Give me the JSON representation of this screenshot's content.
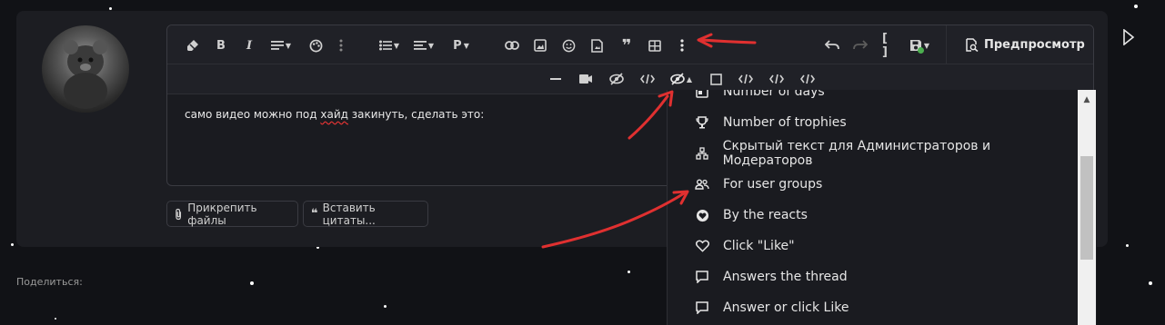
{
  "toolbar": {
    "preview_label": "Предпросмотр",
    "paragraph_label": "P"
  },
  "editor": {
    "text_before": "само видео можно под ",
    "text_misspelled": "хайд",
    "text_after": " закинуть, сделать это:"
  },
  "buttons": {
    "attach_files": "Прикрепить файлы",
    "insert_quotes": "Вставить цитаты..."
  },
  "share_label": "Поделиться:",
  "dropdown": {
    "items": [
      {
        "label": "Number of days",
        "icon": "calendar-icon"
      },
      {
        "label": "Number of trophies",
        "icon": "trophy-icon"
      },
      {
        "label": "Скрытый текст для Администраторов и Модераторов",
        "icon": "sitemap-icon"
      },
      {
        "label": "For user groups",
        "icon": "users-icon"
      },
      {
        "label": "By the reacts",
        "icon": "heart-circle-icon"
      },
      {
        "label": "Click \"Like\"",
        "icon": "heart-icon"
      },
      {
        "label": "Answers the thread",
        "icon": "comment-icon"
      },
      {
        "label": "Answer or click Like",
        "icon": "comment-icon"
      }
    ]
  },
  "colors": {
    "annotation_arrow": "#e03030",
    "page_bg": "#111216",
    "card_bg": "#1c1d22"
  }
}
